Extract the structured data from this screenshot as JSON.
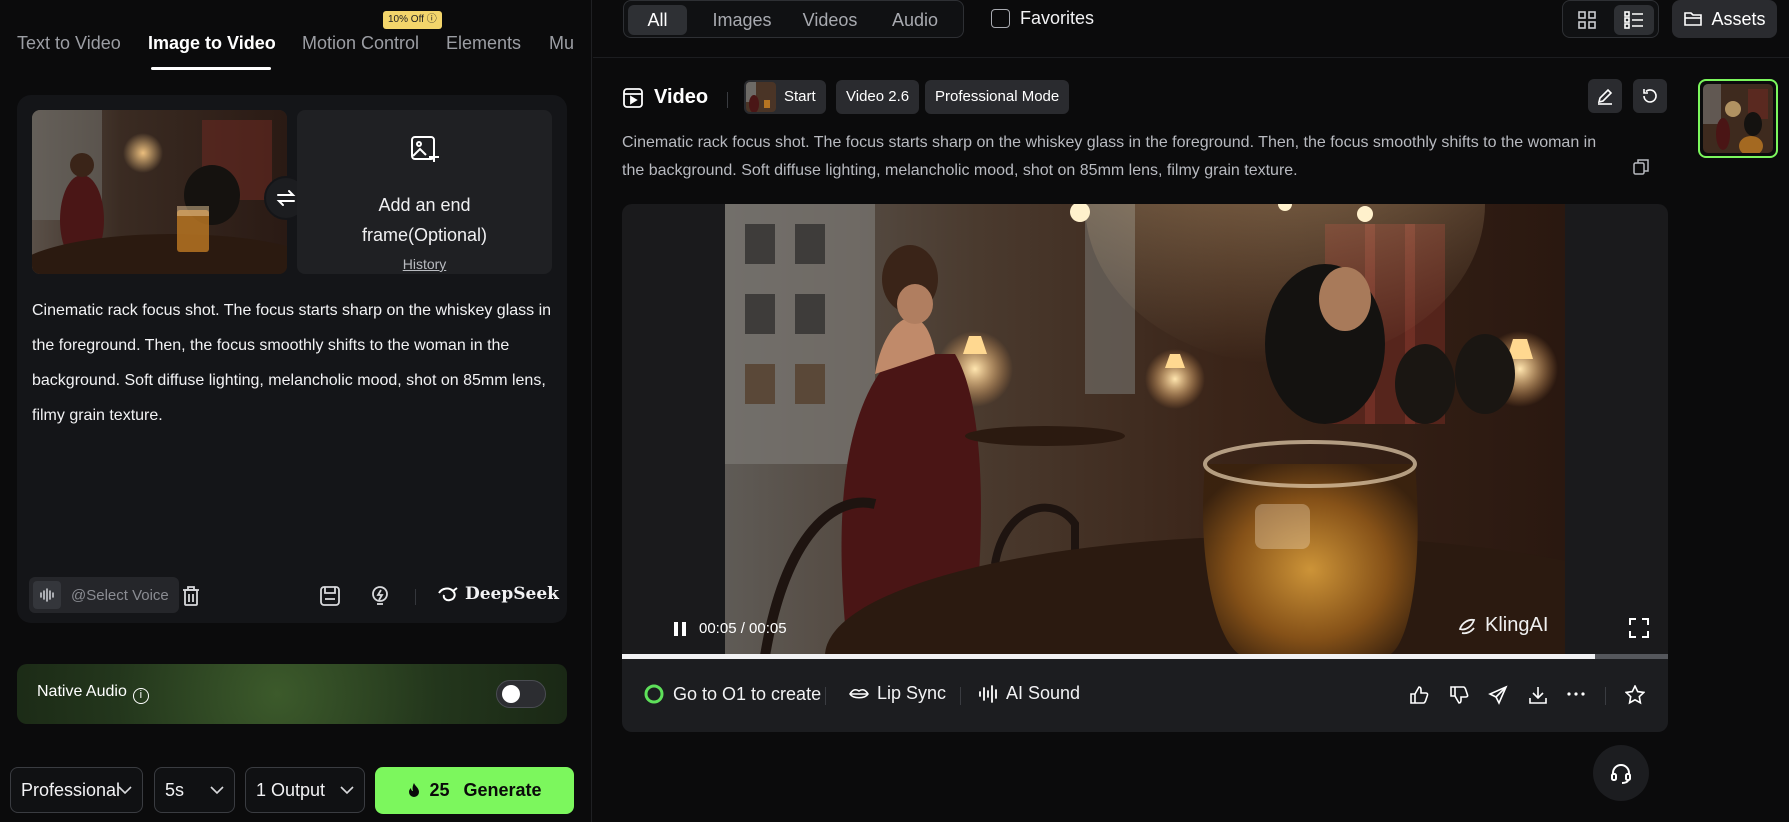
{
  "tabs": [
    {
      "label": "Text to Video",
      "active": false
    },
    {
      "label": "Image to Video",
      "active": true
    },
    {
      "label": "Motion Control",
      "active": false
    },
    {
      "label": "Elements",
      "active": false
    },
    {
      "label": "Mu",
      "active": false
    }
  ],
  "promo_badge": "10% Off ⓘ",
  "end_frame": {
    "title_line1": "Add an end",
    "title_line2": "frame(Optional)",
    "history_link": "History"
  },
  "prompt": {
    "text": "Cinematic rack focus shot. The focus starts sharp on the whiskey glass in the foreground. Then, the focus smoothly shifts to the woman in the background. Soft diffuse lighting, melancholic mood, shot on 85mm lens, filmy grain texture."
  },
  "voice": {
    "placeholder": "@Select Voice"
  },
  "deepseek_label": "DeepSeek",
  "native_audio": {
    "label": "Native Audio",
    "enabled": false
  },
  "bottom_bar": {
    "mode": "Professional",
    "duration": "5s",
    "outputs": "1 Output",
    "cost": "25",
    "generate_label": "Generate"
  },
  "filters": [
    {
      "label": "All",
      "active": true
    },
    {
      "label": "Images",
      "active": false
    },
    {
      "label": "Videos",
      "active": false
    },
    {
      "label": "Audio",
      "active": false
    }
  ],
  "favorites_label": "Favorites",
  "assets_label": "Assets",
  "video_card": {
    "title": "Video",
    "chips": {
      "start": "Start",
      "model": "Video 2.6",
      "mode": "Professional Mode"
    },
    "description": "Cinematic rack focus shot. The focus starts sharp on the whiskey glass in the foreground. Then, the focus smoothly shifts to the woman in the background. Soft diffuse lighting, melancholic mood, shot on 85mm lens, filmy grain texture.",
    "time": "00:05 / 00:05",
    "watermark": "KlingAI",
    "progress": 0.93
  },
  "actions": {
    "go_o1": "Go to O1 to create",
    "lip_sync": "Lip Sync",
    "ai_sound": "AI Sound"
  },
  "colors": {
    "accent_green": "#7cf75d",
    "background": "#0b0b0c",
    "card": "#141518",
    "chip": "#2a2b2f"
  }
}
